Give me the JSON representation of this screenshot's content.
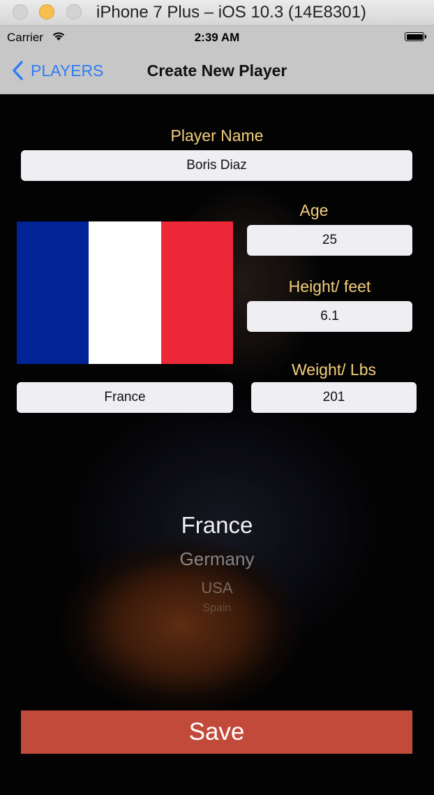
{
  "window": {
    "title": "iPhone 7 Plus – iOS 10.3 (14E8301)"
  },
  "status_bar": {
    "carrier": "Carrier",
    "time": "2:39 AM"
  },
  "nav": {
    "back_label": "PLAYERS",
    "title": "Create New Player"
  },
  "form": {
    "player_name_label": "Player Name",
    "player_name_value": "Boris Diaz",
    "age_label": "Age",
    "age_value": "25",
    "height_label": "Height/ feet",
    "height_value": "6.1",
    "weight_label": "Weight/ Lbs",
    "weight_value": "201",
    "country_value": "France"
  },
  "flag": {
    "colors": [
      "#002395",
      "#ffffff",
      "#ed2939"
    ]
  },
  "picker": {
    "options": [
      "France",
      "Germany",
      "USA",
      "Spain"
    ]
  },
  "save_label": "Save"
}
